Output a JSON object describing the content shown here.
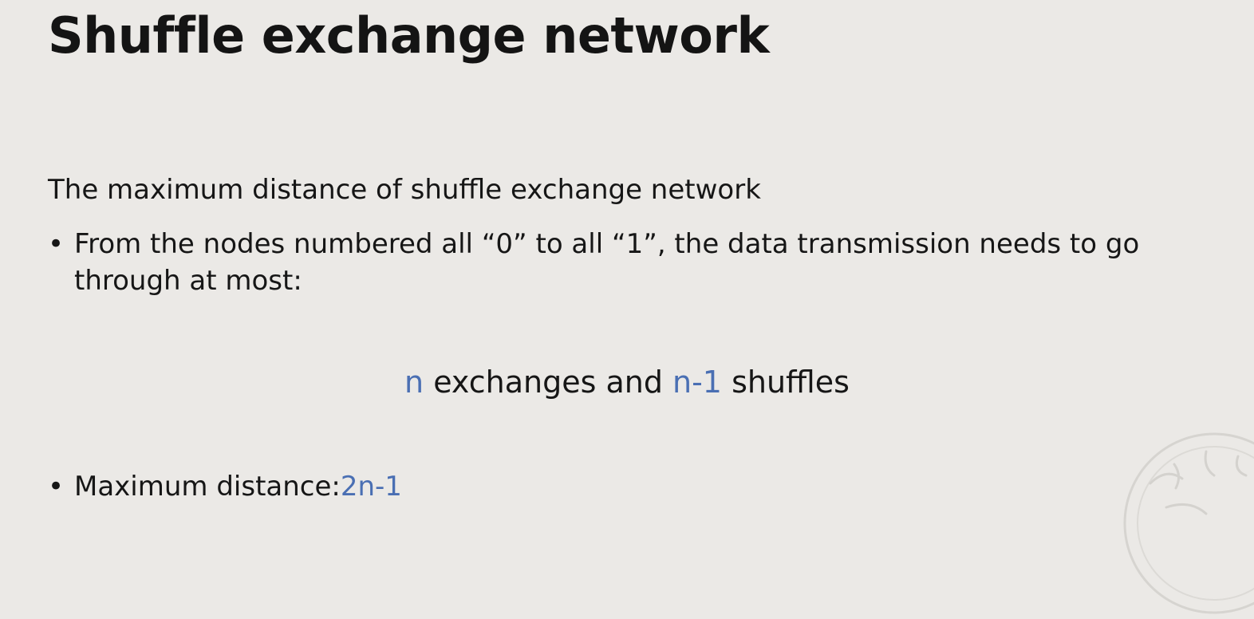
{
  "slide": {
    "title": "Shuffle exchange network",
    "subheading": "The maximum distance of shuffle exchange network",
    "bullet_1": "From the nodes numbered all “0” to all “1”, the data transmission needs to go through at most:",
    "centered": {
      "n": "n",
      "exchanges": " exchanges and ",
      "n_minus_1": "n-1",
      "shuffles": " shuffles"
    },
    "bullet_2": {
      "label": "Maximum distance: ",
      "value": "2n-1"
    },
    "bullet_glyph": "•"
  },
  "colors": {
    "background": "#ebe9e6",
    "text": "#161616",
    "accent": "#4a6fb3"
  }
}
